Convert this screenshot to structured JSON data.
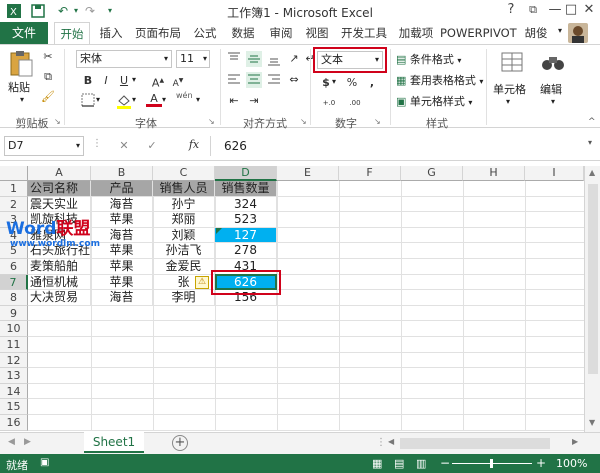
{
  "title": "工作簿1 - Microsoft Excel",
  "window_buttons": {
    "help": "?",
    "restore": "⧉",
    "minimize": "—",
    "maximize": "□",
    "close": "✕"
  },
  "tabs": {
    "file": "文件",
    "items": [
      "开始",
      "插入",
      "页面布局",
      "公式",
      "数据",
      "审阅",
      "视图",
      "开发工具",
      "加载项",
      "POWERPIVOT"
    ],
    "user": "胡俊"
  },
  "ribbon": {
    "clipboard": {
      "paste": "粘贴",
      "group": "剪贴板"
    },
    "font": {
      "name": "宋体",
      "size": "11",
      "bold": "B",
      "italic": "I",
      "underline": "U",
      "grow": "A",
      "shrink": "A",
      "fill_letter": "A",
      "group": "字体",
      "wen": "wén"
    },
    "align": {
      "group": "对齐方式"
    },
    "number": {
      "format": "文本",
      "currency": "$",
      "percent": "%",
      "comma": ",",
      "inc_decimal": "+.0",
      "dec_decimal": ".00",
      "group": "数字"
    },
    "styles": {
      "conditional": "条件格式",
      "table": "套用表格格式",
      "cell": "单元格样式",
      "group": "样式"
    },
    "cells": {
      "label": "单元格"
    },
    "edit": {
      "label": "编辑"
    }
  },
  "formula_bar": {
    "name_box": "D7",
    "cancel": "✕",
    "enter": "✓",
    "fx": "fx",
    "value": "626"
  },
  "columns": [
    "A",
    "B",
    "C",
    "D",
    "E",
    "F",
    "G",
    "H",
    "I"
  ],
  "rows": [
    "1",
    "2",
    "3",
    "4",
    "5",
    "6",
    "7",
    "8",
    "9",
    "10",
    "11",
    "12",
    "13",
    "14",
    "15",
    "16"
  ],
  "table": {
    "header": [
      "公司名称",
      "产品",
      "销售人员",
      "销售数量"
    ],
    "rows": [
      [
        "震天实业",
        "海苔",
        "孙宁",
        "324"
      ],
      [
        "凯旋科技",
        "苹果",
        "郑丽",
        "523"
      ],
      [
        "雅泉网",
        "海苔",
        "刘颖",
        "127"
      ],
      [
        "石头旅行社",
        "苹果",
        "孙洁飞",
        "278"
      ],
      [
        "麦策船舶",
        "苹果",
        "金爱民",
        "431"
      ],
      [
        "通恒机械",
        "苹果",
        "张",
        "626"
      ],
      [
        "大决贸易",
        "海苔",
        "李明",
        "156"
      ]
    ]
  },
  "watermark": {
    "text": "Word联盟",
    "url": "www.wordlm.com"
  },
  "sheet_tabs": [
    "Sheet1"
  ],
  "status": {
    "ready": "就绪",
    "zoom": "100%",
    "minus": "−",
    "plus": "+"
  },
  "colors": {
    "excel_green": "#217346",
    "selection_blue": "#00b0f0",
    "highlight_red": "#d0021b"
  }
}
